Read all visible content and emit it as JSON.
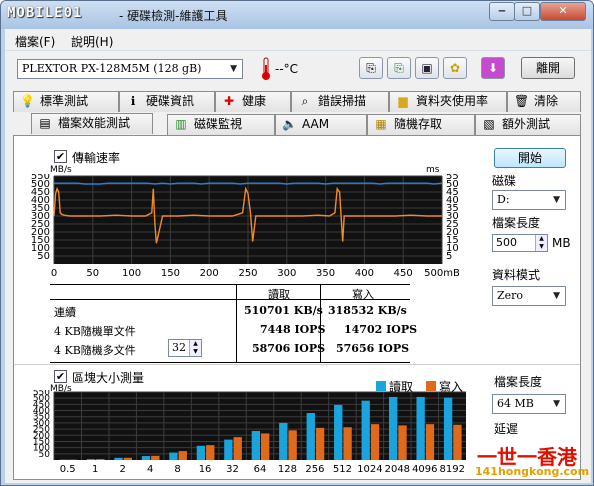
{
  "window": {
    "logo_text": "MOBILE01",
    "title": "- 硬碟檢測-維護工具",
    "min": "‒",
    "max": "□",
    "close": "✕"
  },
  "menu": {
    "file": "檔案(F)",
    "help": "說明(H)"
  },
  "toolbar": {
    "drive": "PLEXTOR PX-128M5M (128 gB)",
    "temp": "--°C",
    "exit": "離開"
  },
  "tabs_top": [
    "標準測試",
    "硬碟資訊",
    "健康",
    "錯誤掃描",
    "資料夾使用率",
    "清除"
  ],
  "tabs_bottom": [
    "檔案效能測試",
    "磁碟監視",
    "AAM",
    "隨機存取",
    "額外測試"
  ],
  "transfer": {
    "checkbox_label": "傳輸速率",
    "left_unit": "MB/s",
    "right_unit": "ms",
    "y_ticks": [
      "550",
      "500",
      "450",
      "400",
      "350",
      "300",
      "250",
      "200",
      "150",
      "100",
      "50"
    ],
    "y2_ticks": [
      "55",
      "50",
      "45",
      "40",
      "35",
      "30",
      "25",
      "20",
      "15",
      "10",
      "5"
    ],
    "x_ticks": [
      "0",
      "50",
      "100",
      "150",
      "200",
      "250",
      "300",
      "350",
      "400",
      "450",
      "500mB"
    ]
  },
  "results": {
    "headers": [
      "讀取",
      "寫入"
    ],
    "rows": [
      {
        "label": "連續",
        "read": "510701 KB/s",
        "write": "318532 KB/s"
      },
      {
        "label": "4 KB隨機單文件",
        "read": "7448 IOPS",
        "write": "14702 IOPS"
      },
      {
        "label": "4 KB隨機多文件",
        "read": "58706 IOPS",
        "write": "57656 IOPS"
      }
    ],
    "queue": "32"
  },
  "side": {
    "start": "開始",
    "disk_label": "磁碟",
    "disk_value": "D:",
    "file_len_label": "檔案長度",
    "file_len_value": "500",
    "file_len_unit": "MB",
    "data_mode_label": "資料模式",
    "data_mode_value": "Zero"
  },
  "block": {
    "checkbox_label": "區塊大小測量",
    "unit": "MB/s",
    "legend_read": "讀取",
    "legend_write": "寫入",
    "file_len_label": "檔案長度",
    "file_len_value": "64 MB",
    "delay_label": "延遲",
    "y_ticks": [
      "550",
      "500",
      "450",
      "400",
      "350",
      "300",
      "250",
      "200",
      "150",
      "100",
      "50"
    ]
  },
  "watermark": {
    "line1": "一世一香港",
    "line2": "141hongkong.com"
  },
  "chart_data": [
    {
      "type": "line",
      "title": "傳輸速率",
      "xlabel": "mB",
      "ylabel": "MB/s",
      "y2label": "ms",
      "xlim": [
        0,
        500
      ],
      "ylim": [
        0,
        550
      ],
      "y2lim": [
        0,
        55
      ],
      "series": [
        {
          "name": "讀取",
          "color": "#2d7fd6",
          "axis": "left",
          "x": [
            0,
            10,
            20,
            30,
            40,
            50,
            60,
            70,
            80,
            90,
            100,
            110,
            120,
            130,
            140,
            150,
            160,
            170,
            180,
            190,
            200,
            210,
            220,
            230,
            240,
            250,
            260,
            270,
            280,
            290,
            300,
            310,
            320,
            330,
            340,
            350,
            360,
            370,
            380,
            390,
            400,
            410,
            420,
            430,
            440,
            450,
            460,
            470,
            480,
            490,
            500
          ],
          "values": [
            505,
            505,
            505,
            505,
            500,
            500,
            500,
            505,
            505,
            505,
            505,
            505,
            505,
            500,
            505,
            500,
            505,
            505,
            505,
            500,
            505,
            505,
            505,
            505,
            500,
            505,
            505,
            505,
            505,
            505,
            500,
            505,
            505,
            505,
            505,
            500,
            505,
            505,
            505,
            505,
            505,
            505,
            500,
            505,
            505,
            505,
            505,
            505,
            505,
            500,
            505
          ]
        },
        {
          "name": "寫入",
          "color": "#f28a2b",
          "axis": "left",
          "x": [
            0,
            2,
            4,
            6,
            8,
            10,
            13,
            20,
            40,
            60,
            80,
            100,
            118,
            126,
            128,
            130,
            132,
            140,
            160,
            180,
            200,
            215,
            230,
            243,
            247,
            250,
            253,
            256,
            260,
            263,
            280,
            300,
            320,
            340,
            355,
            362,
            365,
            368,
            372,
            374,
            380,
            400,
            420,
            440,
            460,
            480,
            500
          ],
          "values": [
            300,
            440,
            470,
            450,
            320,
            310,
            305,
            300,
            300,
            300,
            305,
            300,
            300,
            320,
            470,
            250,
            130,
            300,
            300,
            305,
            300,
            300,
            300,
            320,
            470,
            440,
            330,
            140,
            300,
            300,
            300,
            300,
            300,
            305,
            300,
            320,
            470,
            450,
            140,
            300,
            300,
            300,
            300,
            300,
            305,
            300,
            300
          ]
        }
      ]
    },
    {
      "type": "bar",
      "title": "區塊大小測量",
      "ylabel": "MB/s",
      "ylim": [
        0,
        550
      ],
      "categories": [
        "0.5",
        "1",
        "2",
        "4",
        "8",
        "16",
        "32",
        "64",
        "128",
        "256",
        "512",
        "1024",
        "2048",
        "4096",
        "8192"
      ],
      "series": [
        {
          "name": "讀取",
          "color": "#1aa3dc",
          "values": [
            3,
            8,
            18,
            32,
            60,
            115,
            165,
            235,
            300,
            380,
            445,
            480,
            510,
            510,
            505
          ]
        },
        {
          "name": "寫入",
          "color": "#e06a1c",
          "values": [
            3,
            8,
            18,
            34,
            72,
            120,
            185,
            215,
            240,
            260,
            265,
            290,
            280,
            290,
            285
          ]
        }
      ]
    }
  ]
}
